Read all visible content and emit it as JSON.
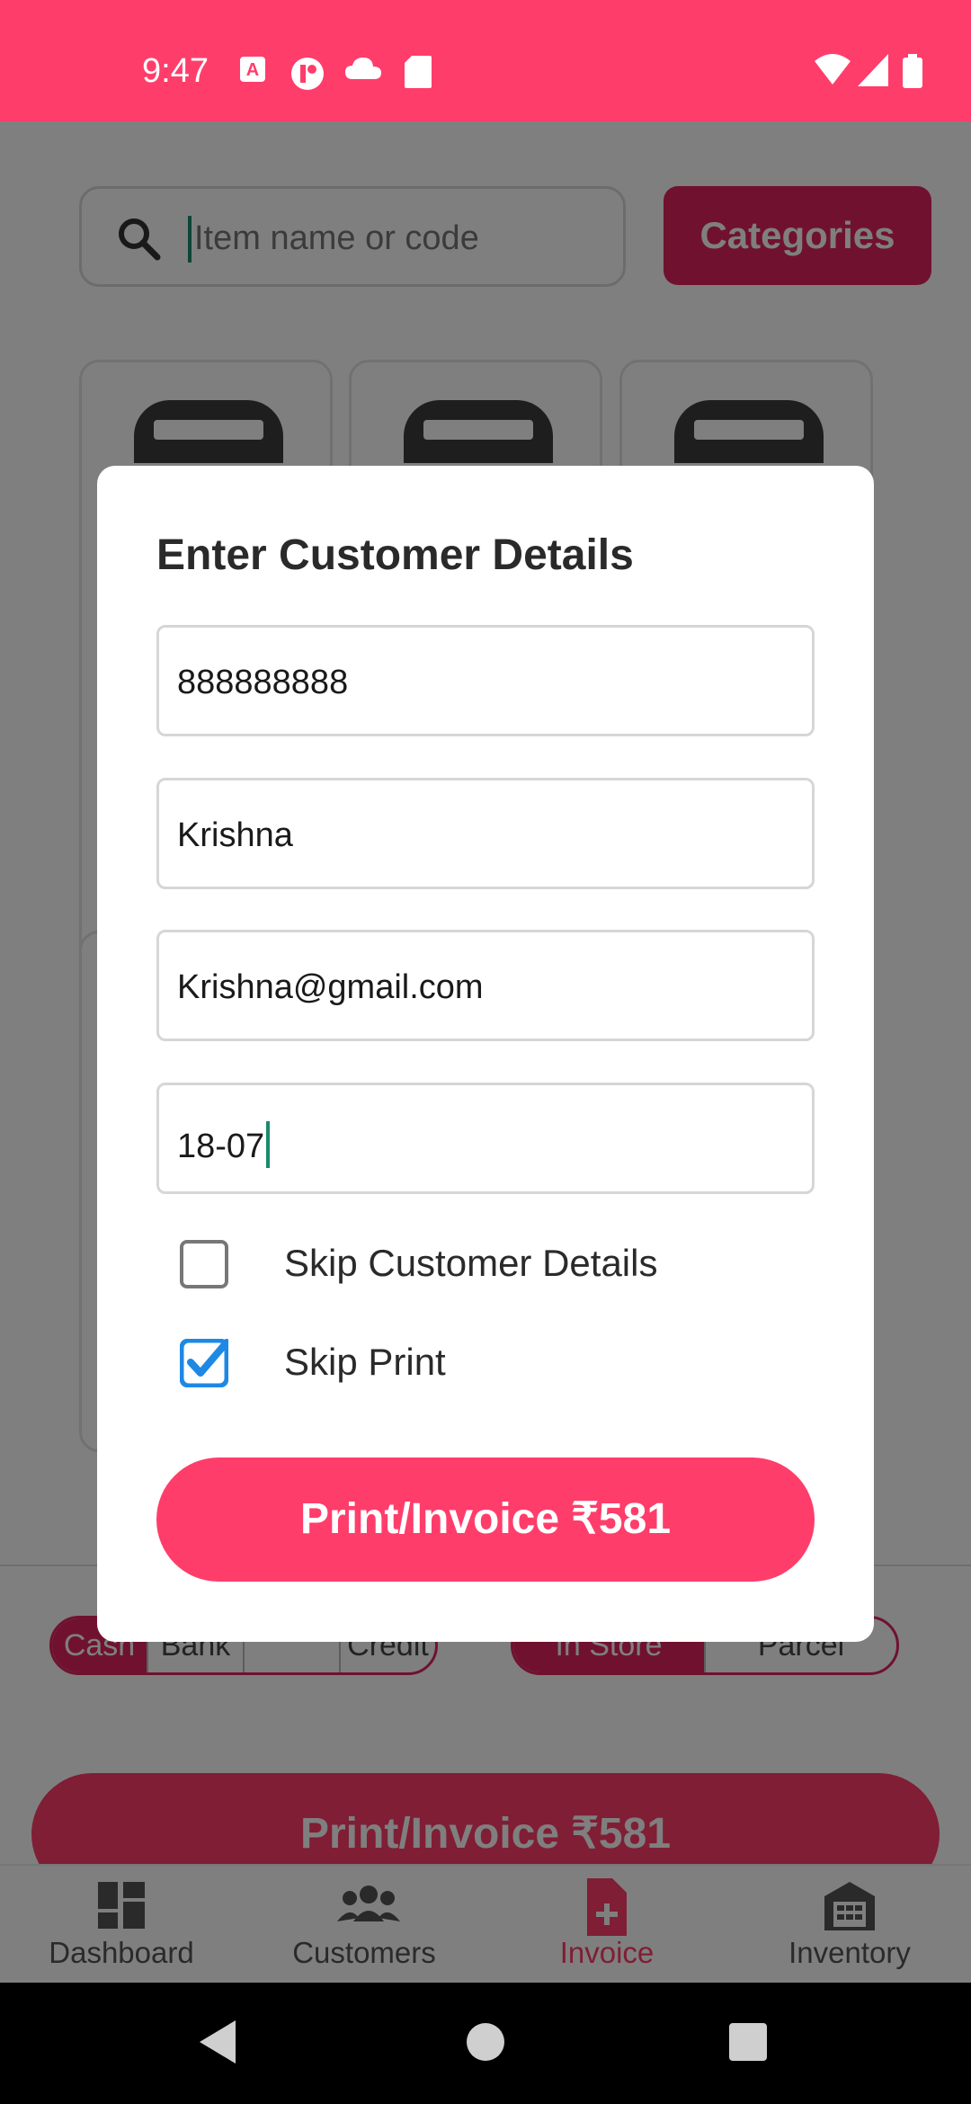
{
  "status_bar": {
    "time": "9:47",
    "icons_left": [
      "font-a-icon",
      "app-icon",
      "cloud-icon",
      "sd-card-icon"
    ],
    "icons_right": [
      "wifi-icon",
      "signal-icon",
      "battery-icon"
    ]
  },
  "search": {
    "placeholder": "Item name or code"
  },
  "categories_label": "Categories",
  "payment_options": [
    "Cash",
    "Bank",
    "",
    "Credit"
  ],
  "order_type_options": [
    "In Store",
    "Parcel"
  ],
  "main_button_label": "Print/Invoice ₹581",
  "bottom_nav": [
    {
      "label": "Dashboard",
      "icon": "dashboard-icon"
    },
    {
      "label": "Customers",
      "icon": "customers-icon"
    },
    {
      "label": "Invoice",
      "icon": "invoice-icon",
      "active": true
    },
    {
      "label": "Inventory",
      "icon": "inventory-icon"
    }
  ],
  "dialog": {
    "title": "Enter Customer Details",
    "phone": "888888888",
    "name": "Krishna",
    "email": "Krishna@gmail.com",
    "date": "18-07",
    "skip_customer_label": "Skip Customer Details",
    "skip_customer_checked": false,
    "skip_print_label": "Skip Print",
    "skip_print_checked": true,
    "button_label": "Print/Invoice ₹581"
  },
  "colors": {
    "accent": "#ff3d6b",
    "accent_dark": "#e0245e",
    "checkbox_blue": "#1e88e5"
  }
}
